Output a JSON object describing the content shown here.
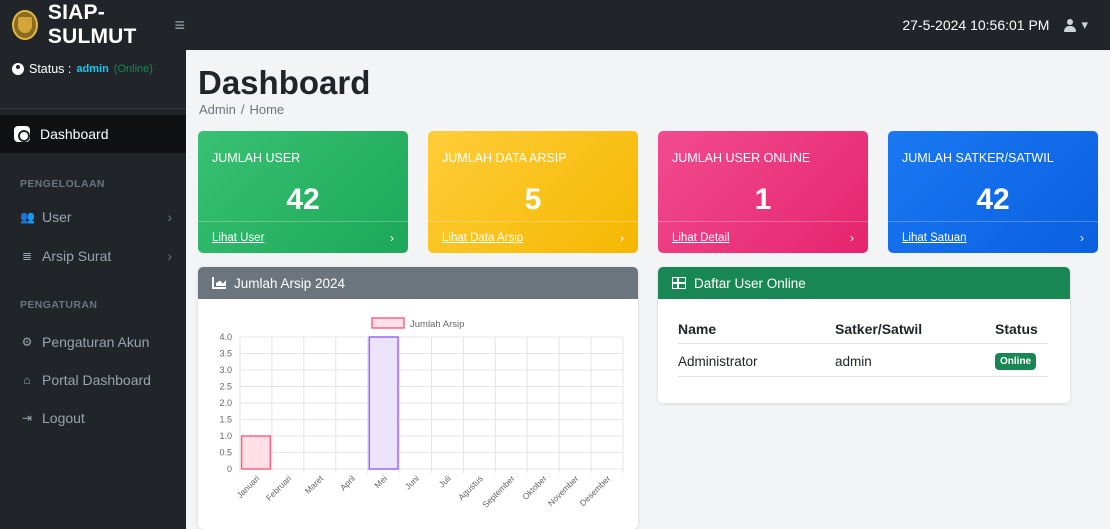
{
  "app": {
    "title": "SIAP-SULMUT",
    "datetime": "27-5-2024 10:56:01 PM"
  },
  "sidebar": {
    "status_label": "Status :",
    "status_user": "admin",
    "status_state": "(Online)",
    "active_item": "Dashboard",
    "section_manage": "PENGELOLAAN",
    "item_user": "User",
    "item_arsip": "Arsip Surat",
    "section_settings": "PENGATURAN",
    "item_account": "Pengaturan Akun",
    "item_portal": "Portal Dashboard",
    "item_logout": "Logout"
  },
  "header": {
    "title": "Dashboard",
    "breadcrumb": [
      "Admin",
      "/",
      "Home"
    ]
  },
  "cards": [
    {
      "title": "JUMLAH USER",
      "value": "42",
      "link": "Lihat User",
      "color": "#28a745"
    },
    {
      "title": "JUMLAH DATA ARSIP",
      "value": "5",
      "link": "Lihat Data Arsip",
      "color": "#ffc107"
    },
    {
      "title": "JUMLAH USER ONLINE",
      "value": "1",
      "link": "Lihat Detail",
      "color": "#e83e8c"
    },
    {
      "title": "JUMLAH SATKER/SATWIL",
      "value": "42",
      "link": "Lihat Satuan",
      "color": "#0d6efd"
    }
  ],
  "chart_panel": {
    "title": "Jumlah Arsip 2024"
  },
  "chart_data": {
    "type": "bar",
    "categories": [
      "Januari",
      "Februari",
      "Maret",
      "April",
      "Mei",
      "Juni",
      "Juli",
      "Agustus",
      "September",
      "Oktober",
      "November",
      "Desember"
    ],
    "series": [
      {
        "name": "Jumlah Arsip",
        "values": [
          1,
          0,
          0,
          0,
          4,
          0,
          0,
          0,
          0,
          0,
          0,
          0
        ]
      }
    ],
    "ylim": [
      0,
      4
    ],
    "yticks": [
      "0",
      "0.5",
      "1.0",
      "1.5",
      "2.0",
      "2.5",
      "3.0",
      "3.5",
      "4.0"
    ],
    "legend": "top",
    "grid": true,
    "colors": {
      "fill": [
        "#ffe0e6",
        "#ece3fb"
      ],
      "stroke": [
        "#ff6384",
        "#9966ff"
      ]
    }
  },
  "online_table": {
    "title": "Daftar User Online",
    "headers": [
      "Name",
      "Satker/Satwil",
      "Status"
    ],
    "rows": [
      {
        "name": "Administrator",
        "satker": "admin",
        "status": "Online"
      }
    ]
  }
}
